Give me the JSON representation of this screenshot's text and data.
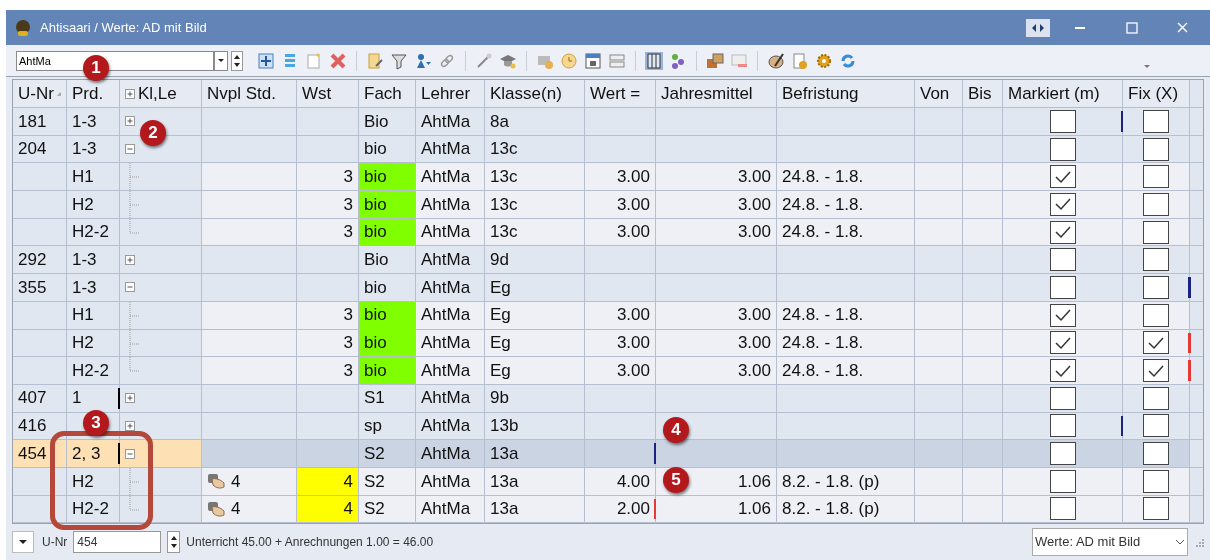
{
  "window": {
    "title": "Ahtisaari / Werte: AD mit Bild"
  },
  "toolbar": {
    "teacher_field": {
      "value": "AhtMa"
    }
  },
  "table": {
    "columns": [
      "U-Nr",
      "Prd.",
      "Kl,Le",
      "Nvpl Std.",
      "Wst",
      "Fach",
      "Lehrer",
      "Klasse(n)",
      "Wert =",
      "Jahresmittel",
      "Befristung",
      "Von",
      "Bis",
      "Markiert (m)",
      "Fix (X)"
    ],
    "rows": [
      {
        "kind": "parent",
        "u_nr": "181",
        "prd": "1-3",
        "expanded": false,
        "fach": "Bio",
        "lehrer": "AhtMa",
        "klasse": "8a",
        "markiert": false,
        "fix": false,
        "flags": [
          {
            "kind": "markiert",
            "color": "#1a237e"
          }
        ]
      },
      {
        "kind": "parent",
        "u_nr": "204",
        "prd": "1-3",
        "expanded": true,
        "fach": "bio",
        "lehrer": "AhtMa",
        "klasse": "13c",
        "markiert": false,
        "fix": false
      },
      {
        "kind": "child",
        "prd": "H1",
        "wst": "3",
        "fach": "bio",
        "fach_highlighted": true,
        "lehrer": "AhtMa",
        "klasse": "13c",
        "wert": "3.00",
        "jahresmittel": "3.00",
        "befristung": "24.8. - 1.8.",
        "markiert": true,
        "fix": false
      },
      {
        "kind": "child",
        "prd": "H2",
        "wst": "3",
        "fach": "bio",
        "fach_highlighted": true,
        "lehrer": "AhtMa",
        "klasse": "13c",
        "wert": "3.00",
        "jahresmittel": "3.00",
        "befristung": "24.8. - 1.8.",
        "markiert": true,
        "fix": false
      },
      {
        "kind": "last_child",
        "prd": "H2-2",
        "wst": "3",
        "fach": "bio",
        "fach_highlighted": true,
        "lehrer": "AhtMa",
        "klasse": "13c",
        "wert": "3.00",
        "jahresmittel": "3.00",
        "befristung": "24.8. - 1.8.",
        "markiert": true,
        "fix": false
      },
      {
        "kind": "parent",
        "u_nr": "292",
        "prd": "1-3",
        "expanded": false,
        "fach": "Bio",
        "lehrer": "AhtMa",
        "klasse": "9d",
        "markiert": false,
        "fix": false
      },
      {
        "kind": "parent",
        "u_nr": "355",
        "prd": "1-3",
        "expanded": true,
        "fach": "bio",
        "lehrer": "AhtMa",
        "klasse": "Eg",
        "markiert": false,
        "fix": false,
        "flags": [
          {
            "kind": "fix",
            "color": "#1a237e"
          }
        ]
      },
      {
        "kind": "child",
        "prd": "H1",
        "wst": "3",
        "fach": "bio",
        "fach_highlighted": true,
        "lehrer": "AhtMa",
        "klasse": "Eg",
        "wert": "3.00",
        "jahresmittel": "3.00",
        "befristung": "24.8. - 1.8.",
        "markiert": true,
        "fix": false
      },
      {
        "kind": "child",
        "prd": "H2",
        "wst": "3",
        "fach": "bio",
        "fach_highlighted": true,
        "lehrer": "AhtMa",
        "klasse": "Eg",
        "wert": "3.00",
        "jahresmittel": "3.00",
        "befristung": "24.8. - 1.8.",
        "markiert": true,
        "fix": true,
        "flags": [
          {
            "kind": "fix",
            "color": "#e53935"
          }
        ]
      },
      {
        "kind": "last_child",
        "prd": "H2-2",
        "wst": "3",
        "fach": "bio",
        "fach_highlighted": true,
        "lehrer": "AhtMa",
        "klasse": "Eg",
        "wert": "3.00",
        "jahresmittel": "3.00",
        "befristung": "24.8. - 1.8.",
        "markiert": true,
        "fix": true,
        "flags": [
          {
            "kind": "fix",
            "color": "#e53935"
          }
        ]
      },
      {
        "kind": "parent",
        "u_nr": "407",
        "prd": "1",
        "expanded": false,
        "fach": "S1",
        "lehrer": "AhtMa",
        "klasse": "9b",
        "markiert": false,
        "fix": false,
        "flags": [
          {
            "kind": "prd",
            "color": "#000000"
          }
        ]
      },
      {
        "kind": "parent",
        "u_nr": "416",
        "expanded": false,
        "fach": "sp",
        "lehrer": "AhtMa",
        "klasse": "13b",
        "markiert": false,
        "fix": false,
        "flags": [
          {
            "kind": "markiert",
            "color": "#1a237e"
          }
        ]
      },
      {
        "kind": "parent",
        "selected": true,
        "u_nr": "454",
        "prd": "2, 3",
        "expanded": true,
        "fach": "S2",
        "lehrer": "AhtMa",
        "klasse": "13a",
        "markiert": false,
        "fix": false,
        "flags": [
          {
            "kind": "prd",
            "color": "#000000"
          },
          {
            "kind": "wert",
            "color": "#1a237e"
          }
        ]
      },
      {
        "kind": "child",
        "prd": "H2",
        "nvpl": "4",
        "wst": "4",
        "wst_highlighted": true,
        "fach": "S2",
        "lehrer": "AhtMa",
        "klasse": "13a",
        "wert": "4.00",
        "jahresmittel": "1.06",
        "befristung": "8.2. - 1.8. (p)",
        "markiert": false,
        "fix": false
      },
      {
        "kind": "last_child",
        "prd": "H2-2",
        "nvpl": "4",
        "wst": "4",
        "wst_highlighted": true,
        "fach": "S2",
        "lehrer": "AhtMa",
        "klasse": "13a",
        "wert": "2.00",
        "jahresmittel": "1.06",
        "befristung": "8.2. - 1.8. (p)",
        "markiert": false,
        "fix": false,
        "flags": [
          {
            "kind": "wert",
            "color": "#e53935"
          }
        ]
      }
    ]
  },
  "footer": {
    "field_label": "U-Nr",
    "field_value": "454",
    "summary": "Unterricht 45.00 + Anrechnungen 1.00 = 46.00",
    "view_select": "Werte: AD mit Bild"
  },
  "callouts": [
    {
      "label": "1"
    },
    {
      "label": "2"
    },
    {
      "label": "3"
    },
    {
      "label": "4"
    },
    {
      "label": "5"
    }
  ]
}
